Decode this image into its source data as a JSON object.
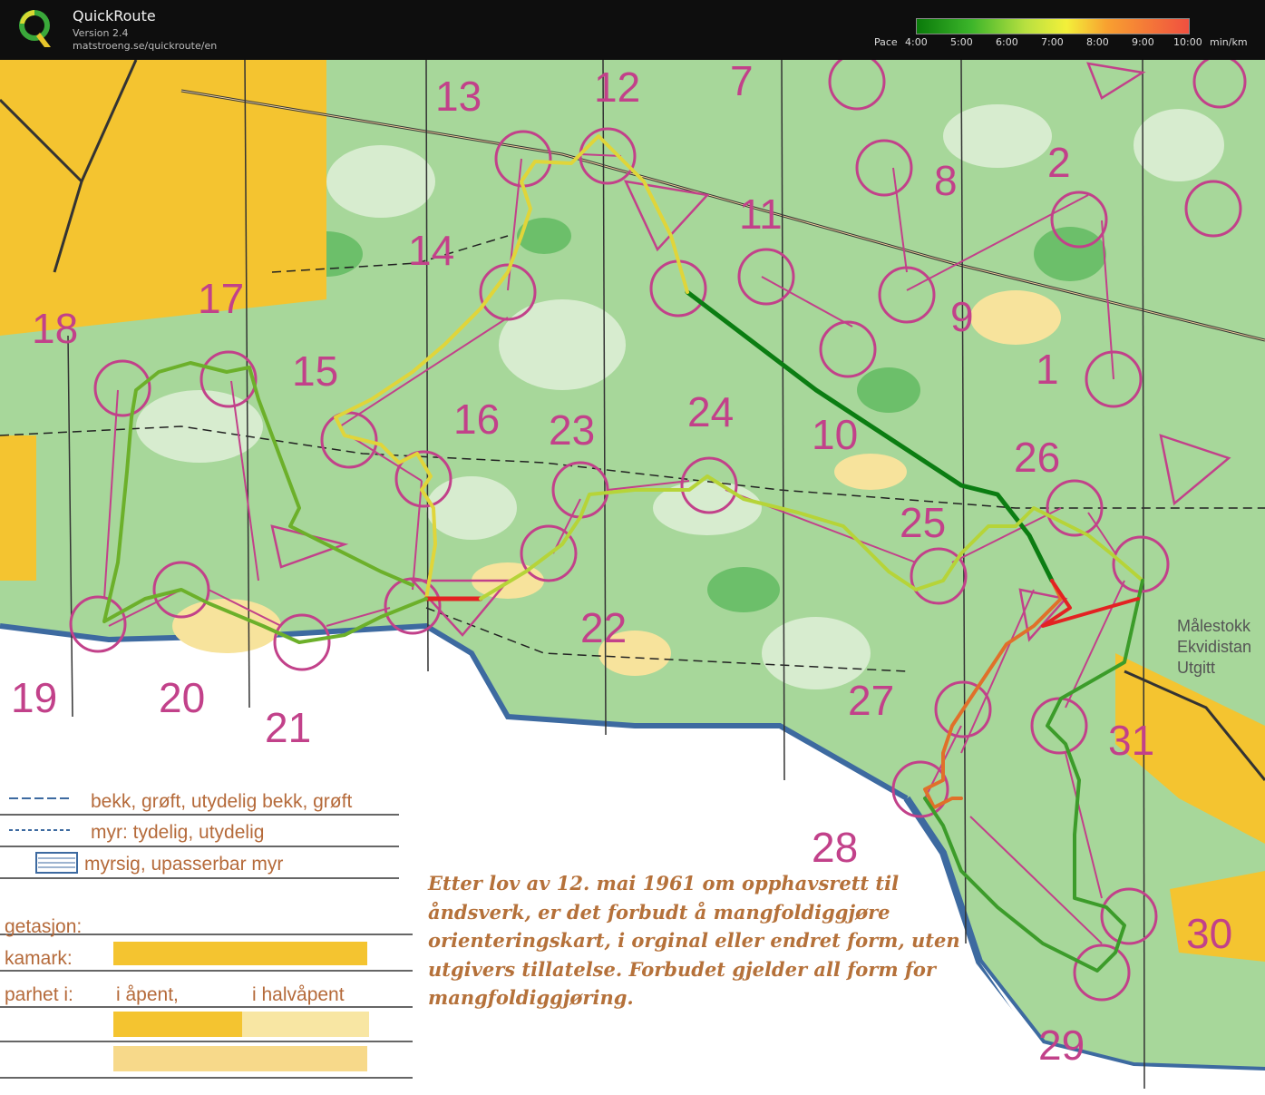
{
  "app": {
    "name": "QuickRoute",
    "version": "Version 2.4",
    "url": "matstroeng.se/quickroute/en",
    "logo_letter": "Q"
  },
  "pace_scale": {
    "label": "Pace",
    "unit": "min/km",
    "ticks": [
      "4:00",
      "5:00",
      "6:00",
      "7:00",
      "8:00",
      "9:00",
      "10:00"
    ]
  },
  "controls": [
    {
      "id": "1",
      "label": "1"
    },
    {
      "id": "2",
      "label": "2"
    },
    {
      "id": "7",
      "label": "7"
    },
    {
      "id": "8",
      "label": "8"
    },
    {
      "id": "9",
      "label": "9"
    },
    {
      "id": "10",
      "label": "10"
    },
    {
      "id": "11",
      "label": "11"
    },
    {
      "id": "12",
      "label": "12"
    },
    {
      "id": "13",
      "label": "13"
    },
    {
      "id": "14",
      "label": "14"
    },
    {
      "id": "15",
      "label": "15"
    },
    {
      "id": "16",
      "label": "16"
    },
    {
      "id": "17",
      "label": "17"
    },
    {
      "id": "18",
      "label": "18"
    },
    {
      "id": "19",
      "label": "19"
    },
    {
      "id": "20",
      "label": "20"
    },
    {
      "id": "21",
      "label": "21"
    },
    {
      "id": "22",
      "label": "22"
    },
    {
      "id": "23",
      "label": "23"
    },
    {
      "id": "24",
      "label": "24"
    },
    {
      "id": "25",
      "label": "25"
    },
    {
      "id": "26",
      "label": "26"
    },
    {
      "id": "27",
      "label": "27"
    },
    {
      "id": "28",
      "label": "28"
    },
    {
      "id": "29",
      "label": "29"
    },
    {
      "id": "30",
      "label": "30"
    },
    {
      "id": "31",
      "label": "31"
    }
  ],
  "legend": {
    "stream": "bekk, grøft, utydelig bekk, grøft",
    "marsh": "myr: tydelig, utydelig",
    "impassable_marsh": "myrsig, upasserbar myr",
    "vegetation": "getasjon:",
    "field": "kamark:",
    "runnability": "parhet i:",
    "open": "i åpent,",
    "semi_open": "i  halvåpent"
  },
  "copyright_notice": "Etter lov av 12. mai 1961 om opphavsrett til åndsverk, er det forbudt å mangfoldiggjøre orienteringskart, i orginal eller endret form, uten utgivers tillatelse. Forbudet gjelder all form for mangfoldiggjøring.",
  "side_note": {
    "line1": "Målestokk",
    "line2": "Ekvidistan",
    "line3": "Utgitt"
  },
  "colors": {
    "course": "#c2418a",
    "forest": "#9bd18f",
    "open_land": "#f6d54a",
    "water": "#3d6aa0",
    "route_fast": "#0b7d12",
    "route_slow": "#e32222"
  }
}
